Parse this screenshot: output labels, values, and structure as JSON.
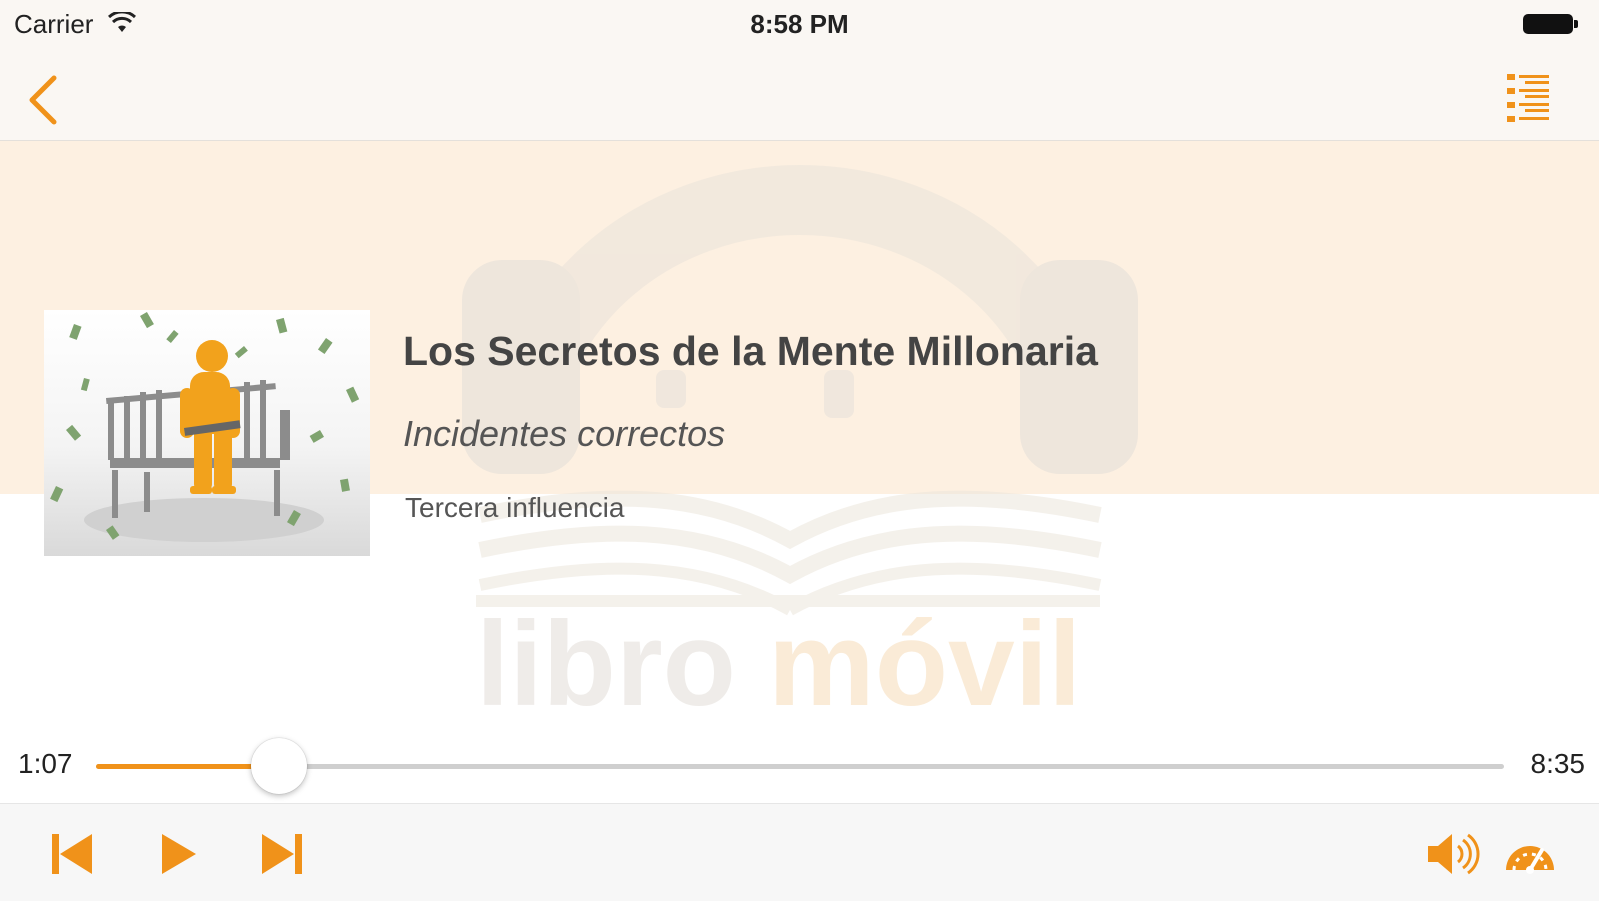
{
  "status_bar": {
    "carrier": "Carrier",
    "time": "8:58 PM"
  },
  "nav_bar": {
    "back_icon": "chevron-left-icon",
    "playlist_icon": "list-icon"
  },
  "colors": {
    "accent": "#f0921a",
    "band": "#fdf0e1",
    "text_dark": "#444444"
  },
  "now_playing": {
    "title": "Los Secretos de la Mente Millonaria",
    "chapter": "Incidentes correctos",
    "section": "Tercera influencia"
  },
  "watermark": {
    "text_part1": "libro",
    "text_part2": "móvil"
  },
  "progress": {
    "elapsed": "1:07",
    "total": "8:35",
    "fraction": 0.13
  },
  "controls": {
    "previous_icon": "skip-previous-icon",
    "play_icon": "play-icon",
    "next_icon": "skip-next-icon",
    "volume_icon": "volume-icon",
    "speed_icon": "speedometer-icon"
  }
}
